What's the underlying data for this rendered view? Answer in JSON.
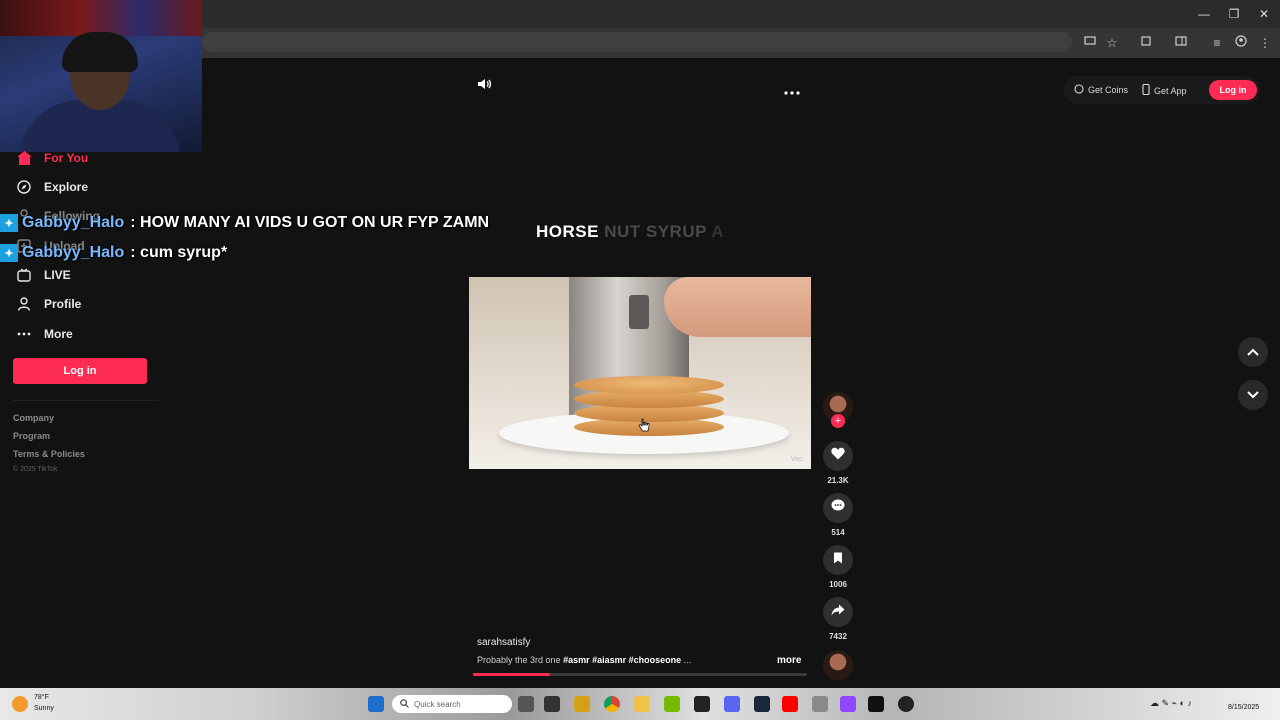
{
  "browser": {
    "window_controls": [
      "—",
      "❐",
      "✕"
    ],
    "toolbar_icons": [
      "cast-icon",
      "star-icon",
      "extensions-icon",
      "sidepanel-icon",
      "media-icon",
      "profile-icon",
      "menu-icon"
    ]
  },
  "sidebar": {
    "items": [
      {
        "label": "For You",
        "icon": "home-icon",
        "active": true
      },
      {
        "label": "Explore",
        "icon": "compass-icon"
      },
      {
        "label": "Following",
        "icon": "people-icon"
      },
      {
        "label": "Upload",
        "icon": "upload-icon"
      },
      {
        "label": "LIVE",
        "icon": "live-icon"
      },
      {
        "label": "Profile",
        "icon": "person-icon"
      },
      {
        "label": "More",
        "icon": "dots-icon"
      }
    ],
    "login_label": "Log in",
    "footer": [
      "Company",
      "Program",
      "Terms & Policies"
    ],
    "copyright": "© 2025 TikTok"
  },
  "chat": [
    {
      "user": "Gabbyy_Halo",
      "message": ": HOW MANY AI VIDS U GOT ON UR FYP ZAMN"
    },
    {
      "user": "Gabbyy_Halo",
      "message": ": cum syrup*"
    }
  ],
  "topbar": {
    "get_coins": "Get Coins",
    "get_app": "Get App",
    "login": "Log in"
  },
  "video": {
    "caption_bright": "HORSE",
    "caption_dim": "NUT SYRUP",
    "caption_tail": "A",
    "watermark": "Veo",
    "author": "sarahsatisfy",
    "description": "Probably the 3rd one",
    "tags": "#asmr #aiasmr #chooseone",
    "ellipsis": "...",
    "more": "more",
    "progress": 0.23
  },
  "actions": {
    "likes": "21.3K",
    "comments": "514",
    "saves": "1006",
    "shares": "7432"
  },
  "taskbar": {
    "weather_temp": "78°F",
    "weather_cond": "Sunny",
    "search_placeholder": "Quick search",
    "date": "8/15/2025"
  },
  "colors": {
    "accent": "#fe2c55",
    "background": "#121212",
    "chat_user": "#79b8ff"
  }
}
